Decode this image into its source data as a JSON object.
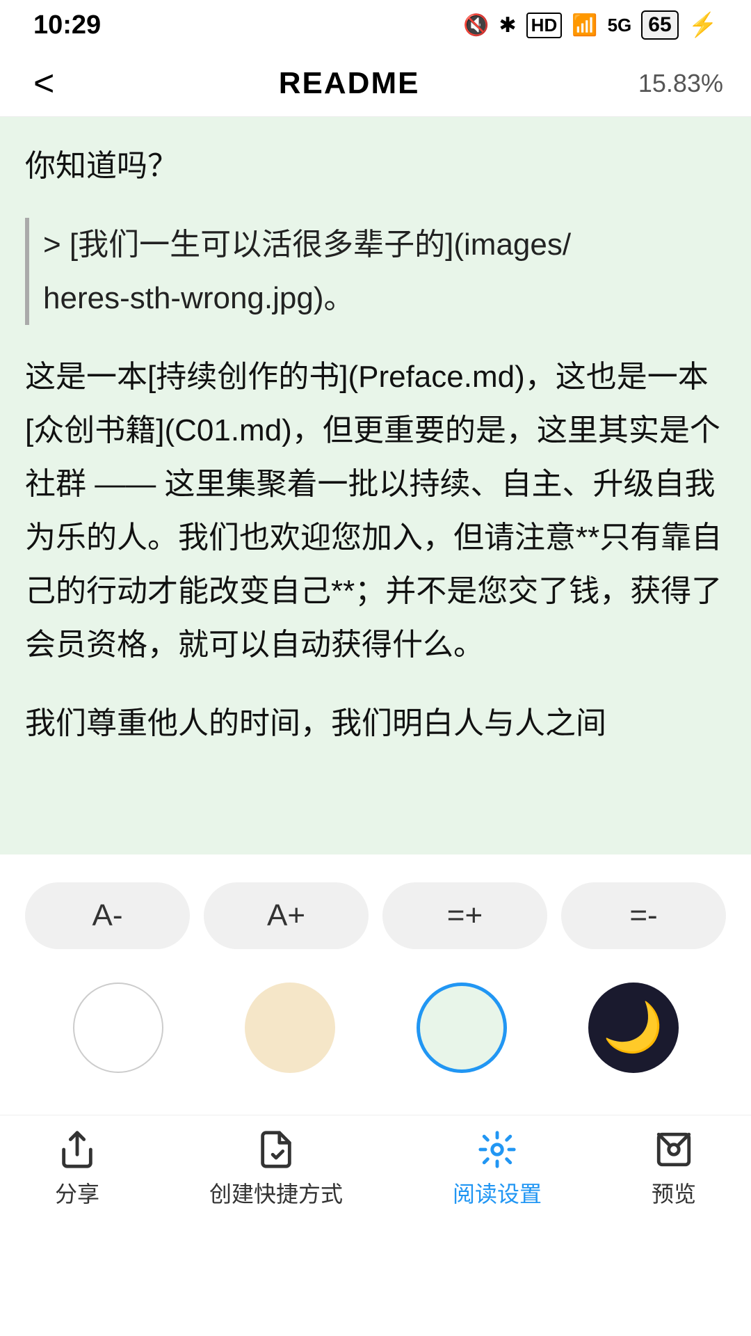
{
  "statusBar": {
    "time": "10:29",
    "batteryLevel": "65"
  },
  "navBar": {
    "backLabel": "<",
    "title": "README",
    "progress": "15.83%"
  },
  "content": {
    "paragraphs": [
      {
        "type": "normal",
        "text": "你知道吗？"
      },
      {
        "type": "blockquote",
        "text": "> [我们一生可以活很多辈子的](images/heres-sth-wrong.jpg)。"
      },
      {
        "type": "normal",
        "text": "这是一本[持续创作的书](Preface.md)，这也是一本[众创书籍](C01.md)，但更重要的是，这里其实是个社群 —— 这里集聚着一批以持续、自主、升级自我为乐的人。我们也欢迎您加入，但请注意**只有靠自己的行动才能改变自己**；并不是您交了钱，获得了会员资格，就可以自动获得什么。"
      },
      {
        "type": "normal",
        "text": "我们尊重他人的时间，我们明白人与人之间"
      }
    ]
  },
  "fontControls": {
    "decreaseFont": "A-",
    "increaseFont": "A+",
    "increaseSpacing": "=+",
    "decreaseSpacing": "=-"
  },
  "themeColors": {
    "white": "#ffffff",
    "cream": "#f5e6c8",
    "green": "#e8f5e9",
    "dark": "#1a1a2e"
  },
  "bottomNav": {
    "items": [
      {
        "id": "share",
        "label": "分享",
        "active": false
      },
      {
        "id": "shortcut",
        "label": "创建快捷方式",
        "active": false
      },
      {
        "id": "reading-settings",
        "label": "阅读设置",
        "active": true
      },
      {
        "id": "preview",
        "label": "预览",
        "active": false
      }
    ]
  }
}
